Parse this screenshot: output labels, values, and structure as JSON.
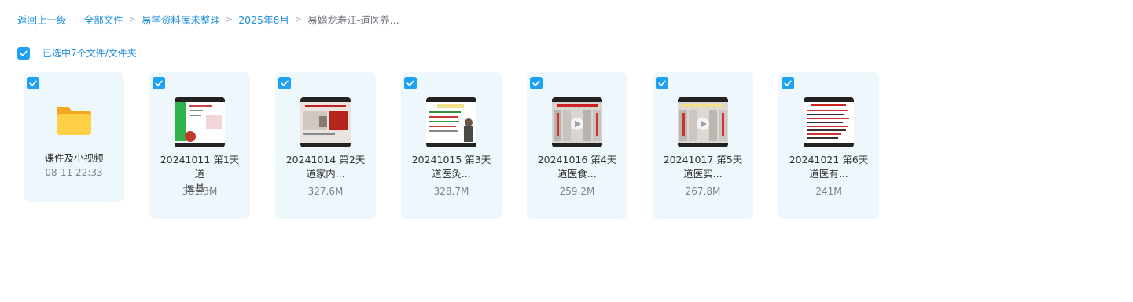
{
  "breadcrumb": {
    "back": "返回上一级",
    "items": [
      "全部文件",
      "易学资料库未整理",
      "2025年6月"
    ],
    "current": "易嫡龙寿江-道医养..."
  },
  "selection": {
    "text": "已选中7个文件/文件夹"
  },
  "files": [
    {
      "type": "folder",
      "icon": "folder-icon",
      "name_lines": [
        "课件及小视频"
      ],
      "meta": "08-11 22:33"
    },
    {
      "type": "video",
      "icon": "video-thumbnail",
      "name_lines": [
        "20241011 第1天 道",
        "医基..."
      ],
      "meta": "381.3M"
    },
    {
      "type": "video",
      "icon": "video-thumbnail",
      "name_lines": [
        "20241014 第2天",
        "道家内..."
      ],
      "meta": "327.6M"
    },
    {
      "type": "video",
      "icon": "video-thumbnail",
      "name_lines": [
        "20241015 第3天",
        "道医灸..."
      ],
      "meta": "328.7M"
    },
    {
      "type": "video",
      "icon": "video-thumbnail",
      "name_lines": [
        "20241016 第4天",
        "道医食..."
      ],
      "meta": "259.2M"
    },
    {
      "type": "video",
      "icon": "video-thumbnail",
      "name_lines": [
        "20241017 第5天",
        "道医实..."
      ],
      "meta": "267.8M"
    },
    {
      "type": "video",
      "icon": "video-thumbnail",
      "name_lines": [
        "20241021 第6天",
        "道医有..."
      ],
      "meta": "241M"
    }
  ],
  "colors": {
    "accent": "#1da1f2",
    "card_bg": "#eef7fc",
    "folder": "#ffc93c"
  }
}
